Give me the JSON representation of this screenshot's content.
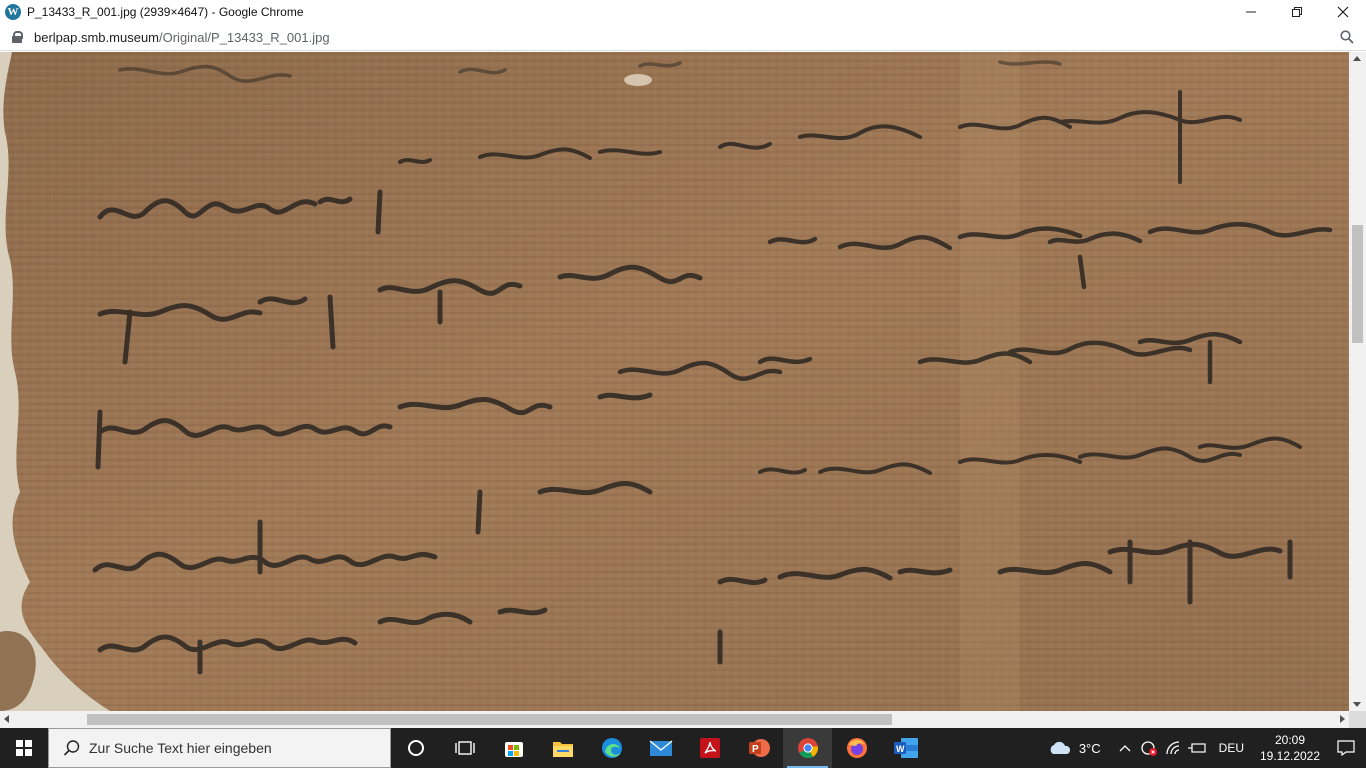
{
  "window": {
    "title": "P_13433_R_001.jpg (2939×4647) - Google Chrome",
    "app_icon": "wordpress-icon",
    "controls": [
      "minimize",
      "restore",
      "close"
    ]
  },
  "addressbar": {
    "domain": "berlpap.smb.museum",
    "path": "/Original/P_13433_R_001.jpg"
  },
  "content": {
    "image_alt": "Greek papyrus fragment P 13433 recto"
  },
  "taskbar": {
    "search_placeholder": "Zur Suche Text hier eingeben",
    "apps": [
      {
        "name": "cortana-icon"
      },
      {
        "name": "task-view-icon"
      },
      {
        "name": "microsoft-store-icon"
      },
      {
        "name": "file-explorer-icon"
      },
      {
        "name": "edge-icon"
      },
      {
        "name": "mail-icon"
      },
      {
        "name": "acrobat-icon"
      },
      {
        "name": "powerpoint-icon"
      },
      {
        "name": "chrome-icon",
        "active": true
      },
      {
        "name": "firefox-icon"
      },
      {
        "name": "word-icon"
      }
    ],
    "tray": {
      "weather": "3°C",
      "language": "DEU",
      "time": "20:09",
      "date": "19.12.2022"
    }
  },
  "colors": {
    "papyrus": "#9c7552",
    "ink": "#2b2621",
    "taskbar": "#202020"
  }
}
